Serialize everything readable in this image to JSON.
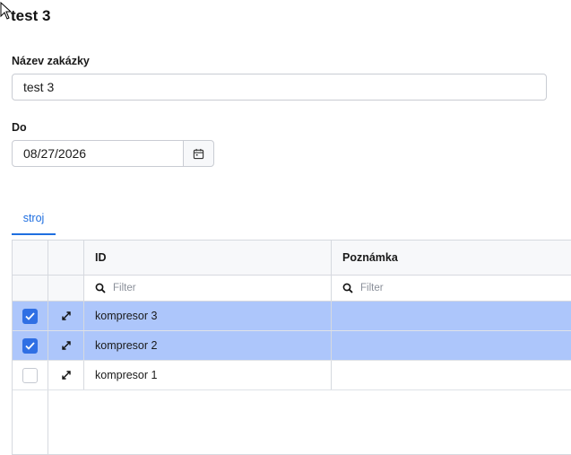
{
  "form": {
    "title": "test 3",
    "name_label": "Název zakázky",
    "name_value": "test 3",
    "date_label": "Do",
    "date_value": "08/27/2026"
  },
  "tabs": [
    {
      "label": "stroj",
      "active": true
    }
  ],
  "grid": {
    "columns": [
      "ID",
      "Poznámka"
    ],
    "filter_placeholder": "Filter",
    "rows": [
      {
        "id": "kompresor 3",
        "note": "",
        "selected": true
      },
      {
        "id": "kompresor 2",
        "note": "",
        "selected": true
      },
      {
        "id": "kompresor 1",
        "note": "",
        "selected": false
      }
    ]
  },
  "colors": {
    "accent": "#1f6fe0",
    "selected_row": "#adc6fb",
    "checkbox": "#2f6fe4"
  },
  "icons": [
    "cursor-icon",
    "calendar-icon",
    "search-icon",
    "expand-icon",
    "check-icon"
  ]
}
